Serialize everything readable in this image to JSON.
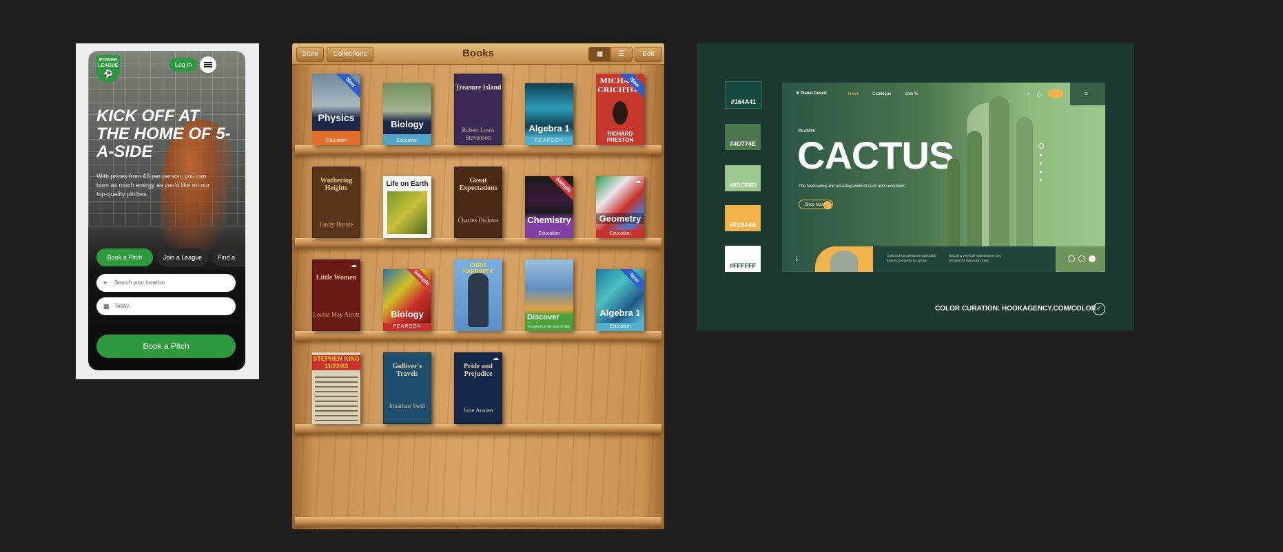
{
  "mobile": {
    "brand_line1": "POWER",
    "brand_line2": "LEAGUE",
    "login": "Log in",
    "headline": "KICK OFF AT THE HOME OF 5-A-SIDE",
    "subtext": "With prices from £5 per person, you can burn as much energy as you'd like on our top-quality pitches.",
    "tabs": [
      "Book a Pitch",
      "Join a League",
      "Find a"
    ],
    "location_placeholder": "Search your location",
    "date_value": "Today",
    "cta": "Book a Pitch"
  },
  "bookshelf": {
    "title": "Books",
    "store": "Store",
    "collections": "Collections",
    "edit": "Edit",
    "books": [
      {
        "title": "Physics",
        "label": "Education",
        "badge": "New",
        "color": "#e06f2c"
      },
      {
        "title": "Biology",
        "label": "Education",
        "color": "#4fa4c8"
      },
      {
        "title": "Treasure Island",
        "author": "Robert Louis Stevenson",
        "color": "#3b2a55"
      },
      {
        "title": "Algebra 1",
        "label": "PEARSON",
        "color": "#1f7893"
      },
      {
        "title": "MICHAEL CRICHTON",
        "author": "RICHARD PRESTON",
        "badge": "New",
        "color": "#c7372b"
      },
      {
        "title": "Wuthering Heights",
        "author": "Emily Brontë",
        "color": "#5a3418"
      },
      {
        "title": "Life on Earth",
        "color": "#f3f3f0"
      },
      {
        "title": "Great Expectations",
        "author": "Charles Dickens",
        "color": "#4a2a14"
      },
      {
        "title": "Chemistry",
        "label": "Education",
        "badge": "Sample",
        "color": "#7f3fa3"
      },
      {
        "title": "Geometry",
        "label": "Education",
        "color": "#c8322c"
      },
      {
        "title": "Little Women",
        "author": "Louisa May Alcott",
        "color": "#6a1a14"
      },
      {
        "title": "Biology",
        "label": "PEARSON",
        "badge": "Sample",
        "color": "#c8322c"
      },
      {
        "title": "CHRIS HARDWICK",
        "color": "#6ea6d8"
      },
      {
        "title": "Discover Italy",
        "label": "Experience the best of Italy",
        "color": "#4aa23c"
      },
      {
        "title": "Algebra 1",
        "label": "Education",
        "badge": "New",
        "color": "#2e8ab0"
      },
      {
        "title": "STEPHEN KING 11/22/63",
        "color": "#d9d0b8"
      },
      {
        "title": "Gulliver's Travels",
        "author": "Jonathan Swift",
        "color": "#1f4f6e"
      },
      {
        "title": "Pride and Prejudice",
        "author": "Jane Austen",
        "color": "#14284a"
      }
    ]
  },
  "colors": {
    "swatches": [
      "#164A41",
      "#4D774E",
      "#9DC88D",
      "#F1B24A",
      "#FFFFFF"
    ],
    "site": {
      "brand": "Planet Desert",
      "nav": [
        "Home",
        "Catalogue",
        "Sale %"
      ],
      "eyebrow": "PLANTS",
      "headline": "CACTUS",
      "tagline": "The fascinating and amazing world of cacti and succulents",
      "shop": "Shop Now",
      "note1": "Cacti and succulents are particularly easy indoor plants to care for.",
      "note2": "Requiring very little maintenance, they are ideal for every plant lover."
    },
    "credit": "COLOR CURATION: HOOKAGENCY.COM/COLOR"
  }
}
